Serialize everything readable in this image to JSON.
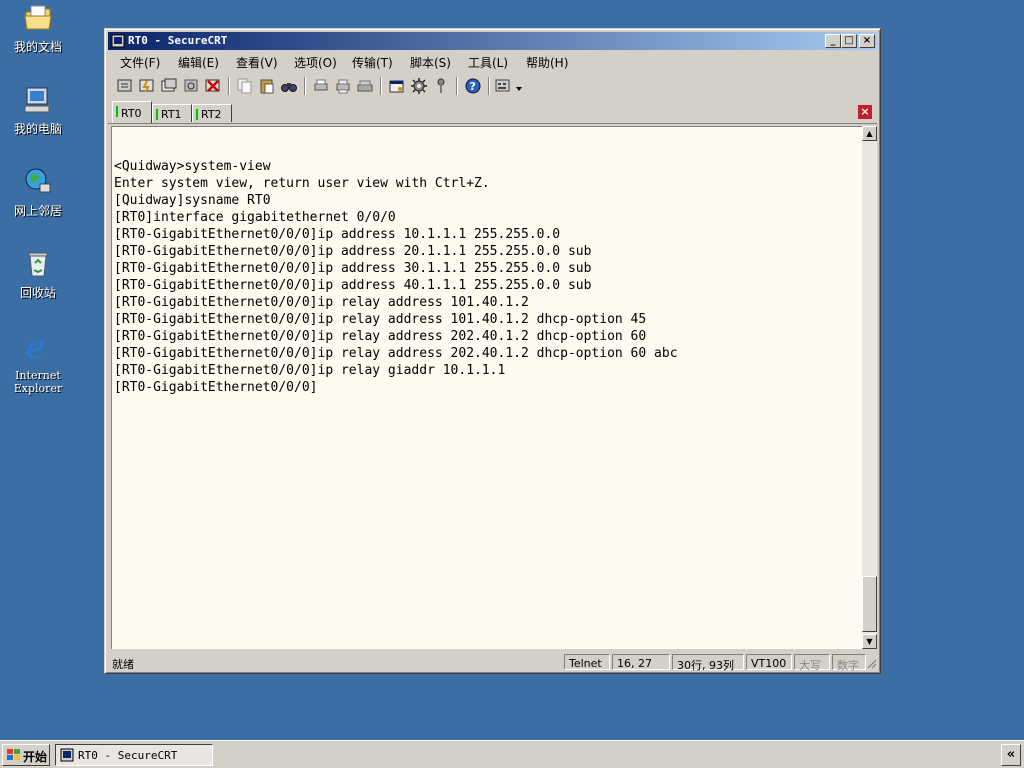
{
  "desktop": {
    "icons": [
      {
        "label": "我的文档"
      },
      {
        "label": "我的电脑"
      },
      {
        "label": "网上邻居"
      },
      {
        "label": "回收站"
      },
      {
        "label": "Internet Explorer"
      }
    ]
  },
  "window": {
    "title": "RT0 - SecureCRT",
    "buttons": {
      "minimize": "_",
      "maximize": "□",
      "close": "×"
    }
  },
  "menu": [
    {
      "label": "文件(F)"
    },
    {
      "label": "编辑(E)"
    },
    {
      "label": "查看(V)"
    },
    {
      "label": "选项(O)"
    },
    {
      "label": "传输(T)"
    },
    {
      "label": "脚本(S)"
    },
    {
      "label": "工具(L)"
    },
    {
      "label": "帮助(H)"
    }
  ],
  "tabs": [
    {
      "label": "RT0",
      "active": true
    },
    {
      "label": "RT1",
      "active": false
    },
    {
      "label": "RT2",
      "active": false
    }
  ],
  "terminal": {
    "lines": [
      "<Quidway>system-view",
      "Enter system view, return user view with Ctrl+Z.",
      "[Quidway]sysname RT0",
      "[RT0]interface gigabitethernet 0/0/0",
      "[RT0-GigabitEthernet0/0/0]ip address 10.1.1.1 255.255.0.0",
      "[RT0-GigabitEthernet0/0/0]ip address 20.1.1.1 255.255.0.0 sub",
      "[RT0-GigabitEthernet0/0/0]ip address 30.1.1.1 255.255.0.0 sub",
      "[RT0-GigabitEthernet0/0/0]ip address 40.1.1.1 255.255.0.0 sub",
      "[RT0-GigabitEthernet0/0/0]ip relay address 101.40.1.2",
      "[RT0-GigabitEthernet0/0/0]ip relay address 101.40.1.2 dhcp-option 45",
      "[RT0-GigabitEthernet0/0/0]ip relay address 202.40.1.2 dhcp-option 60",
      "[RT0-GigabitEthernet0/0/0]ip relay address 202.40.1.2 dhcp-option 60 abc",
      "[RT0-GigabitEthernet0/0/0]ip relay giaddr 10.1.1.1",
      "[RT0-GigabitEthernet0/0/0]"
    ]
  },
  "status": {
    "ready": "就绪",
    "protocol": "Telnet",
    "cursor": "16,  27",
    "size": "30行, 93列",
    "emulation": "VT100",
    "caps": "大写",
    "num": "数字"
  },
  "taskbar": {
    "start": "开始",
    "task": "RT0 - SecureCRT",
    "tray": "«"
  },
  "colors": {
    "desktop": "#3a6ea5",
    "titlebar_start": "#0a246a",
    "terminal_bg": "#fdfbef"
  }
}
